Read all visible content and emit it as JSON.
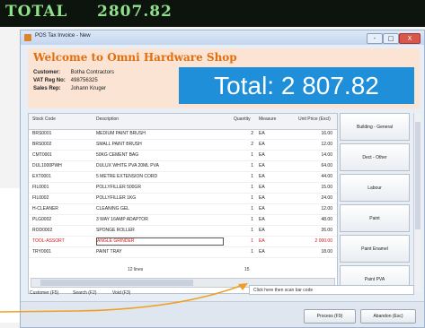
{
  "pole_display": {
    "label": "TOTAL",
    "amount": "2807.82"
  },
  "window": {
    "title": "POS Tax Invoice - New",
    "controls": [
      "-",
      "□",
      "X"
    ]
  },
  "header": {
    "welcome": "Welcome to Omni Hardware Shop",
    "customer_label": "Customer:",
    "customer_value": "Botha Contractors",
    "vat_label": "VAT Reg No:",
    "vat_value": "498756325",
    "rep_label": "Sales Rep:",
    "rep_value": "Johann Kruger",
    "total_display": "Total: 2 807.82"
  },
  "table": {
    "columns": [
      "Stock Code",
      "Description",
      "Quantity",
      "Measure",
      "Unit Price (Excl)"
    ],
    "rows": [
      {
        "code": "BRS0001",
        "desc": "MEDIUM PAINT BRUSH",
        "qty": "2",
        "meas": "EA",
        "price": "16.00",
        "red": false
      },
      {
        "code": "BRS0002",
        "desc": "SMALL PAINT BRUSH",
        "qty": "2",
        "meas": "EA",
        "price": "12.00",
        "red": false
      },
      {
        "code": "CMT0001",
        "desc": "50KG CEMENT BAG",
        "qty": "1",
        "meas": "EA",
        "price": "14.00",
        "red": false
      },
      {
        "code": "DUL1000PWH",
        "desc": "DULUX WHITE PVA 20ML PVA",
        "qty": "1",
        "meas": "EA",
        "price": "64.00",
        "red": false
      },
      {
        "code": "EXT0001",
        "desc": "5 METRE EXTENSION CORD",
        "qty": "1",
        "meas": "EA",
        "price": "44.00",
        "red": false
      },
      {
        "code": "FIL0001",
        "desc": "POLLYFILLER 500GR",
        "qty": "1",
        "meas": "EA",
        "price": "15.00",
        "red": false
      },
      {
        "code": "FIL0002",
        "desc": "POLLYFILLER 1KG",
        "qty": "1",
        "meas": "EA",
        "price": "24.00",
        "red": false
      },
      {
        "code": "H-CLEANER",
        "desc": "CLEANING GEL",
        "qty": "1",
        "meas": "EA",
        "price": "12.00",
        "red": false
      },
      {
        "code": "PLG0002",
        "desc": "3 WAY 16AMP ADAPTOR",
        "qty": "1",
        "meas": "EA",
        "price": "48.00",
        "red": false
      },
      {
        "code": "ROD0002",
        "desc": "SPONGE ROLLER",
        "qty": "1",
        "meas": "EA",
        "price": "26.00",
        "red": false
      },
      {
        "code": "TOOL-ASSORT",
        "desc": "ANGLE GRINDER",
        "qty": "1",
        "meas": "EA",
        "price": "2 000.00",
        "red": true
      },
      {
        "code": "TRY0001",
        "desc": "PAINT TRAY",
        "qty": "1",
        "meas": "EA",
        "price": "18.00",
        "red": false
      }
    ],
    "footer_lines": "12 lines",
    "footer_qty": "15"
  },
  "categories": [
    "Building - General",
    "Dect - Other",
    "Labour",
    "Paint",
    "Paint Enamel",
    "Paint PVA"
  ],
  "shortcuts": [
    "Customer (F5)",
    "Search (F2)",
    "Void (F3)"
  ],
  "scan_placeholder": "Click here then scan bar code",
  "actions": {
    "process": "Process (F9)",
    "abandon": "Abandon (Esc)"
  },
  "colors": {
    "pole_bg": "#0d130d",
    "pole_text": "#8fe08a",
    "header_bg": "#fbe4d4",
    "welcome": "#e06f10",
    "total_bg": "#1e8fd8",
    "red_row": "#d01818",
    "pointer": "#f0a020"
  }
}
